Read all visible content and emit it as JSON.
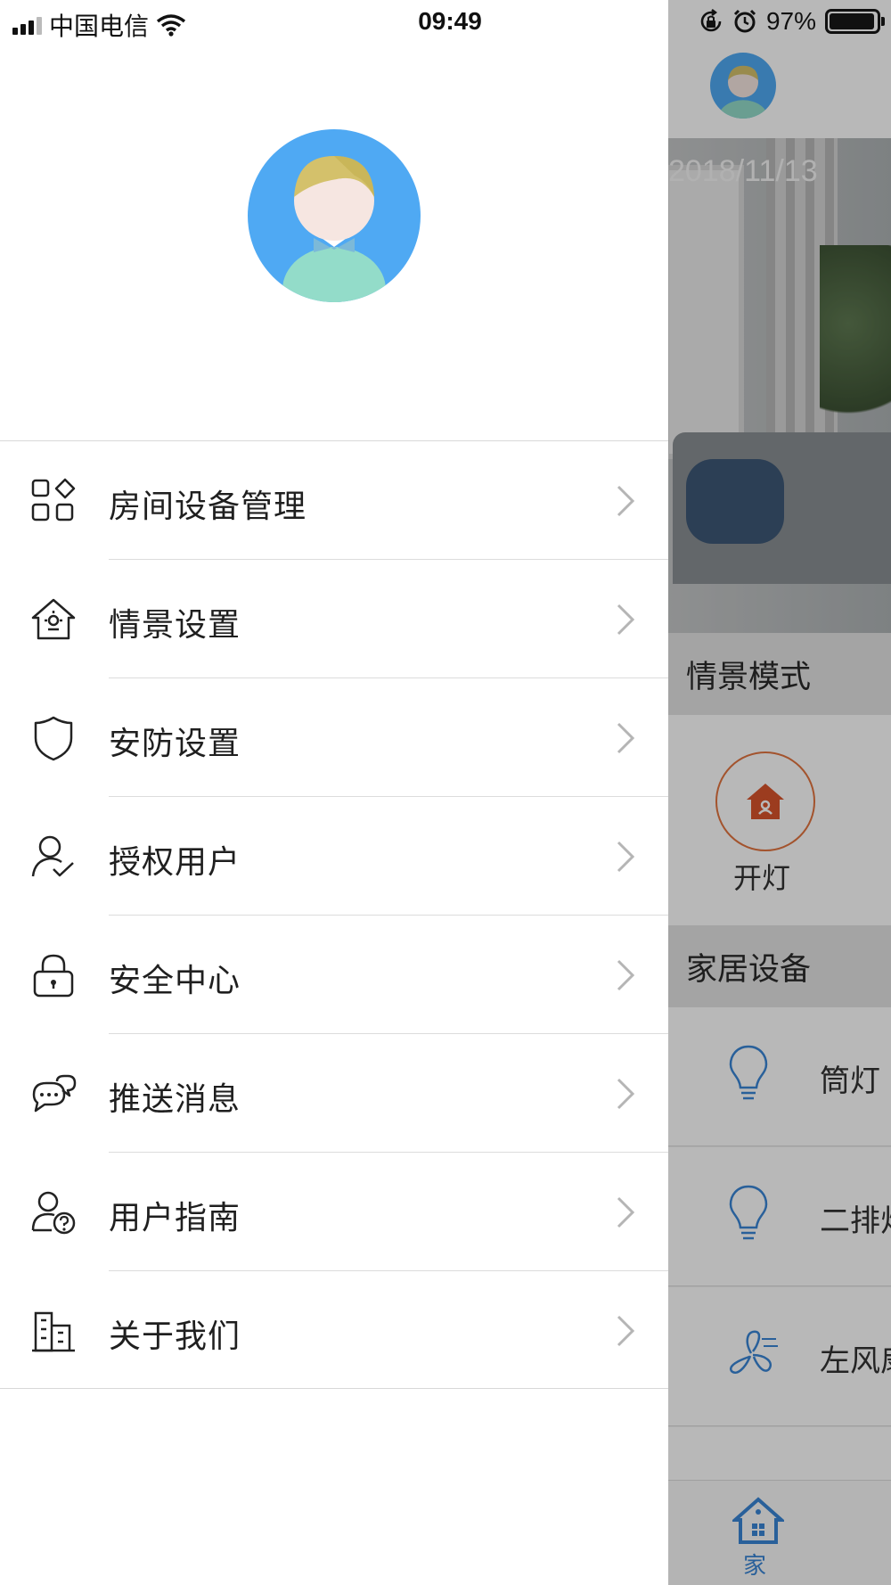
{
  "status_bar": {
    "carrier": "中国电信",
    "time": "09:49",
    "battery": "97%",
    "battery_level": 0.97,
    "icons": [
      "signal-icon",
      "wifi-icon",
      "rotation-lock-icon",
      "alarm-icon",
      "battery-icon"
    ]
  },
  "drawer": {
    "menu": [
      {
        "label": "房间设备管理",
        "icon": "grid-apps-icon"
      },
      {
        "label": "情景设置",
        "icon": "scene-house-icon"
      },
      {
        "label": "安防设置",
        "icon": "shield-icon"
      },
      {
        "label": "授权用户",
        "icon": "user-check-icon"
      },
      {
        "label": "安全中心",
        "icon": "lock-icon"
      },
      {
        "label": "推送消息",
        "icon": "chat-bubbles-icon"
      },
      {
        "label": "用户指南",
        "icon": "user-help-icon"
      },
      {
        "label": "关于我们",
        "icon": "building-icon"
      }
    ]
  },
  "main": {
    "banner_date": "2018/11/13",
    "scene_header": "情景模式",
    "scene_item": "开灯",
    "devices_header": "家居设备",
    "devices": [
      {
        "label": "筒灯",
        "icon": "bulb-icon"
      },
      {
        "label": "二排灯",
        "icon": "bulb-icon"
      },
      {
        "label": "左风扇",
        "icon": "fan-icon"
      }
    ],
    "tab_home": "家"
  },
  "colors": {
    "accent_blue": "#4fa9f3",
    "scene_orange": "#e2743f",
    "tab_blue": "#3a86d6"
  }
}
